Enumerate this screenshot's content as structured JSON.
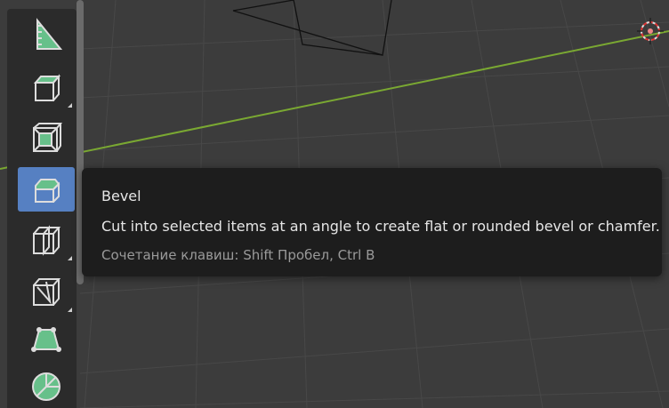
{
  "tooltip": {
    "title": "Bevel",
    "description": "Cut into selected items at an angle to create flat or rounded bevel or chamfer.",
    "shortcut": "Сочетание клавиш: Shift Пробел, Ctrl B"
  },
  "toolbar": {
    "tools": [
      {
        "name": "measure",
        "icon": "measure-icon",
        "active": false,
        "has_submenu": false
      },
      {
        "name": "add-cube",
        "icon": "add-cube-icon",
        "active": false,
        "has_submenu": true
      },
      {
        "name": "inset-faces",
        "icon": "inset-faces-icon",
        "active": false,
        "has_submenu": false
      },
      {
        "name": "bevel",
        "icon": "bevel-icon",
        "active": true,
        "has_submenu": false
      },
      {
        "name": "loop-cut",
        "icon": "loop-cut-icon",
        "active": false,
        "has_submenu": true
      },
      {
        "name": "knife",
        "icon": "knife-icon",
        "active": false,
        "has_submenu": true
      },
      {
        "name": "poly-build",
        "icon": "poly-build-icon",
        "active": false,
        "has_submenu": false
      },
      {
        "name": "spin",
        "icon": "spin-icon",
        "active": false,
        "has_submenu": false
      }
    ]
  },
  "colors": {
    "accent": "#5680c2",
    "tooltip_bg": "#1d1d1d",
    "axis_line": "#7aa832",
    "icon_green": "#67c08a"
  }
}
